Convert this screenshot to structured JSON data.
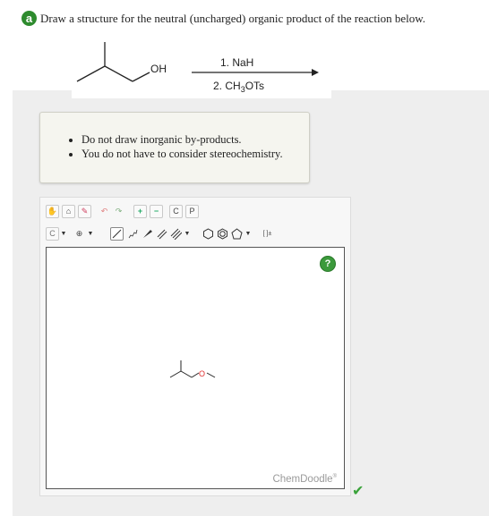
{
  "question": {
    "badge": "a",
    "text": "Draw a structure for the neutral (uncharged) organic product of the reaction below."
  },
  "reaction": {
    "substituent_label": "OH",
    "step1": "1. NaH",
    "step2_prefix": "2. CH",
    "step2_sub": "3",
    "step2_suffix": "OTs"
  },
  "notes": [
    "Do not draw inorganic by-products.",
    "You do not have to consider stereochemistry."
  ],
  "editor": {
    "element_select": "C",
    "help_icon": "?",
    "brand": "ChemDoodle",
    "brand_mark": "®",
    "drawn_atom_label": "O",
    "buttons_row1": [
      {
        "name": "pan-hand-icon",
        "glyph": "✋"
      },
      {
        "name": "lasso-icon",
        "glyph": "⌂"
      },
      {
        "name": "eraser-icon",
        "glyph": "✎"
      },
      {
        "name": "undo-icon",
        "glyph": "↶"
      },
      {
        "name": "redo-icon",
        "glyph": "↷"
      },
      {
        "name": "zoom-in-icon",
        "glyph": "+"
      },
      {
        "name": "zoom-out-icon",
        "glyph": "−"
      },
      {
        "name": "copy-icon",
        "glyph": "C"
      },
      {
        "name": "paste-icon",
        "glyph": "P"
      }
    ],
    "bracket_label": "[ ]±"
  },
  "status": {
    "check_icon": "✔"
  },
  "colors": {
    "badge_green": "#2e8b2e",
    "oxygen_red": "#e03030",
    "check_green": "#3aa33a"
  }
}
